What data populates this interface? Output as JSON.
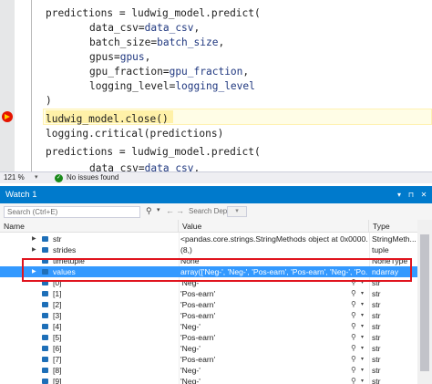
{
  "editor": {
    "lines": [
      {
        "type": "call_start",
        "text": "predictions = ludwig_model.predict("
      },
      {
        "type": "arg",
        "name": "data_csv",
        "value": "data_csv"
      },
      {
        "type": "arg",
        "name": "batch_size",
        "value": "batch_size"
      },
      {
        "type": "arg",
        "name": "gpus",
        "value": "gpus"
      },
      {
        "type": "arg",
        "name": "gpu_fraction",
        "value": "gpu_fraction"
      },
      {
        "type": "arg",
        "name": "logging_level",
        "value": "logging_level"
      },
      {
        "type": "plain",
        "text": ")"
      },
      {
        "type": "current",
        "text": "ludwig_model.close()"
      },
      {
        "type": "plain",
        "text": "logging.critical(predictions)"
      },
      {
        "type": "call_start",
        "text": "predictions = ludwig_model.predict("
      },
      {
        "type": "arg",
        "name": "data_csv",
        "value": "data_csv"
      }
    ]
  },
  "status_bar": {
    "zoom": "121 %",
    "issues": "No issues found"
  },
  "watch": {
    "title": "Watch 1",
    "search_placeholder": "Search (Ctrl+E)",
    "search_depth_label": "Search Depth:",
    "columns": {
      "name": "Name",
      "value": "Value",
      "type": "Type"
    },
    "rows": [
      {
        "name": "str",
        "value": "<pandas.core.strings.StringMethods object at 0x0000...",
        "type": "StringMeth...",
        "expandable": true,
        "selected": false
      },
      {
        "name": "strides",
        "value": "(8,)",
        "type": "tuple",
        "expandable": true,
        "selected": false
      },
      {
        "name": "timetuple",
        "value": "None",
        "type": "NoneType",
        "expandable": false,
        "selected": false
      },
      {
        "name": "values",
        "value": "array(['Neg-', 'Neg-', 'Pos-earn', 'Pos-earn', 'Neg-', 'Po...",
        "type": "ndarray",
        "expandable": true,
        "selected": true
      },
      {
        "name": "[0]",
        "value": "'Neg-'",
        "type": "str",
        "expandable": false,
        "selected": false
      },
      {
        "name": "[1]",
        "value": "'Pos-earn'",
        "type": "str",
        "expandable": false,
        "selected": false
      },
      {
        "name": "[2]",
        "value": "'Pos-earn'",
        "type": "str",
        "expandable": false,
        "selected": false
      },
      {
        "name": "[3]",
        "value": "'Pos-earn'",
        "type": "str",
        "expandable": false,
        "selected": false
      },
      {
        "name": "[4]",
        "value": "'Neg-'",
        "type": "str",
        "expandable": false,
        "selected": false
      },
      {
        "name": "[5]",
        "value": "'Pos-earn'",
        "type": "str",
        "expandable": false,
        "selected": false
      },
      {
        "name": "[6]",
        "value": "'Neg-'",
        "type": "str",
        "expandable": false,
        "selected": false
      },
      {
        "name": "[7]",
        "value": "'Pos-earn'",
        "type": "str",
        "expandable": false,
        "selected": false
      },
      {
        "name": "[8]",
        "value": "'Neg-'",
        "type": "str",
        "expandable": false,
        "selected": false
      },
      {
        "name": "[9]",
        "value": "'Neg-'",
        "type": "str",
        "expandable": false,
        "selected": false
      }
    ]
  },
  "colors": {
    "title_bar": "#007acc",
    "selection": "#3399ff",
    "highlight": "#e0141e",
    "param_color": "#1f377f"
  }
}
